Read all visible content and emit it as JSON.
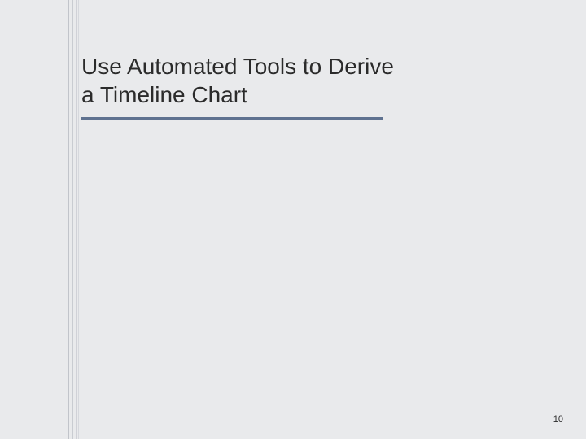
{
  "slide": {
    "title": "Use Automated Tools to Derive a Timeline Chart",
    "page_number": "10"
  }
}
